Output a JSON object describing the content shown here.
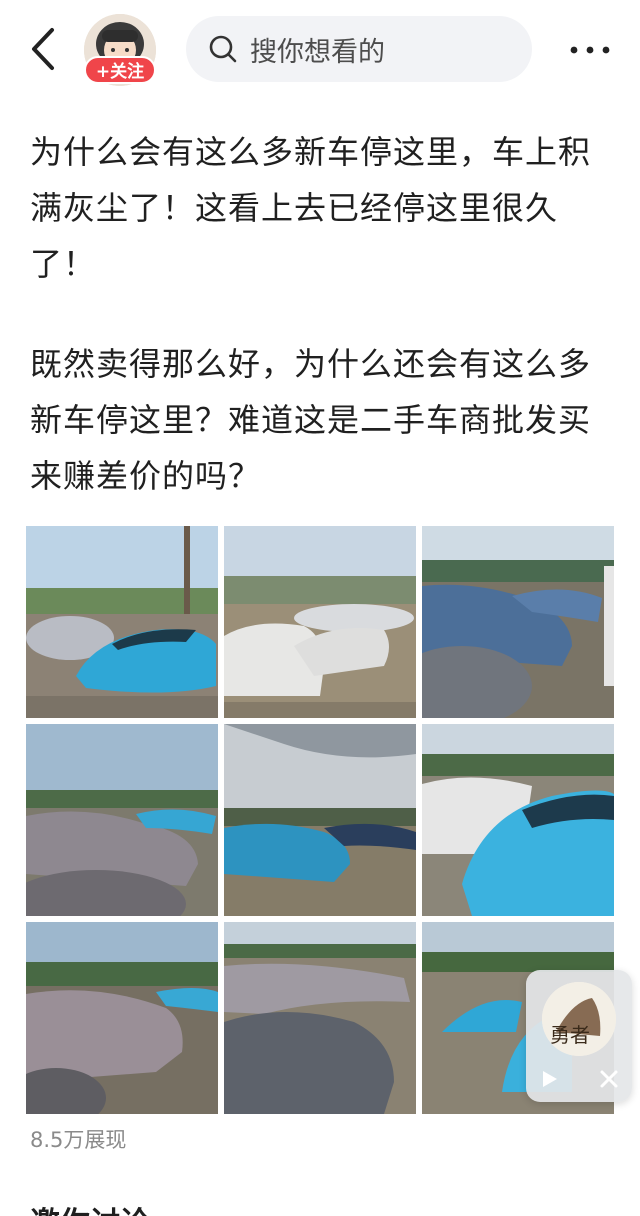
{
  "header": {
    "back_icon": "chevron-left-icon",
    "follow_label": "+关注",
    "search_placeholder": "搜你想看的",
    "more_icon": "more-dots-icon"
  },
  "post": {
    "paragraphs": [
      "为什么会有这么多新车停这里，车上积满灰尘了！这看上去已经停这里很久了！",
      "既然卖得那么好，为什么还会有这么多新车停这里？难道这是二手车商批发买来赚差价的吗？"
    ]
  },
  "images": {
    "count": 9
  },
  "floating_player": {
    "thumb_text": "勇者"
  },
  "stats": {
    "views": "8.5万展现"
  },
  "discuss": {
    "label": "邀你讨论"
  },
  "colors": {
    "follow_red": "#f0454a",
    "car_blue": "#2fa7d6",
    "car_grey": "#6e7480"
  }
}
